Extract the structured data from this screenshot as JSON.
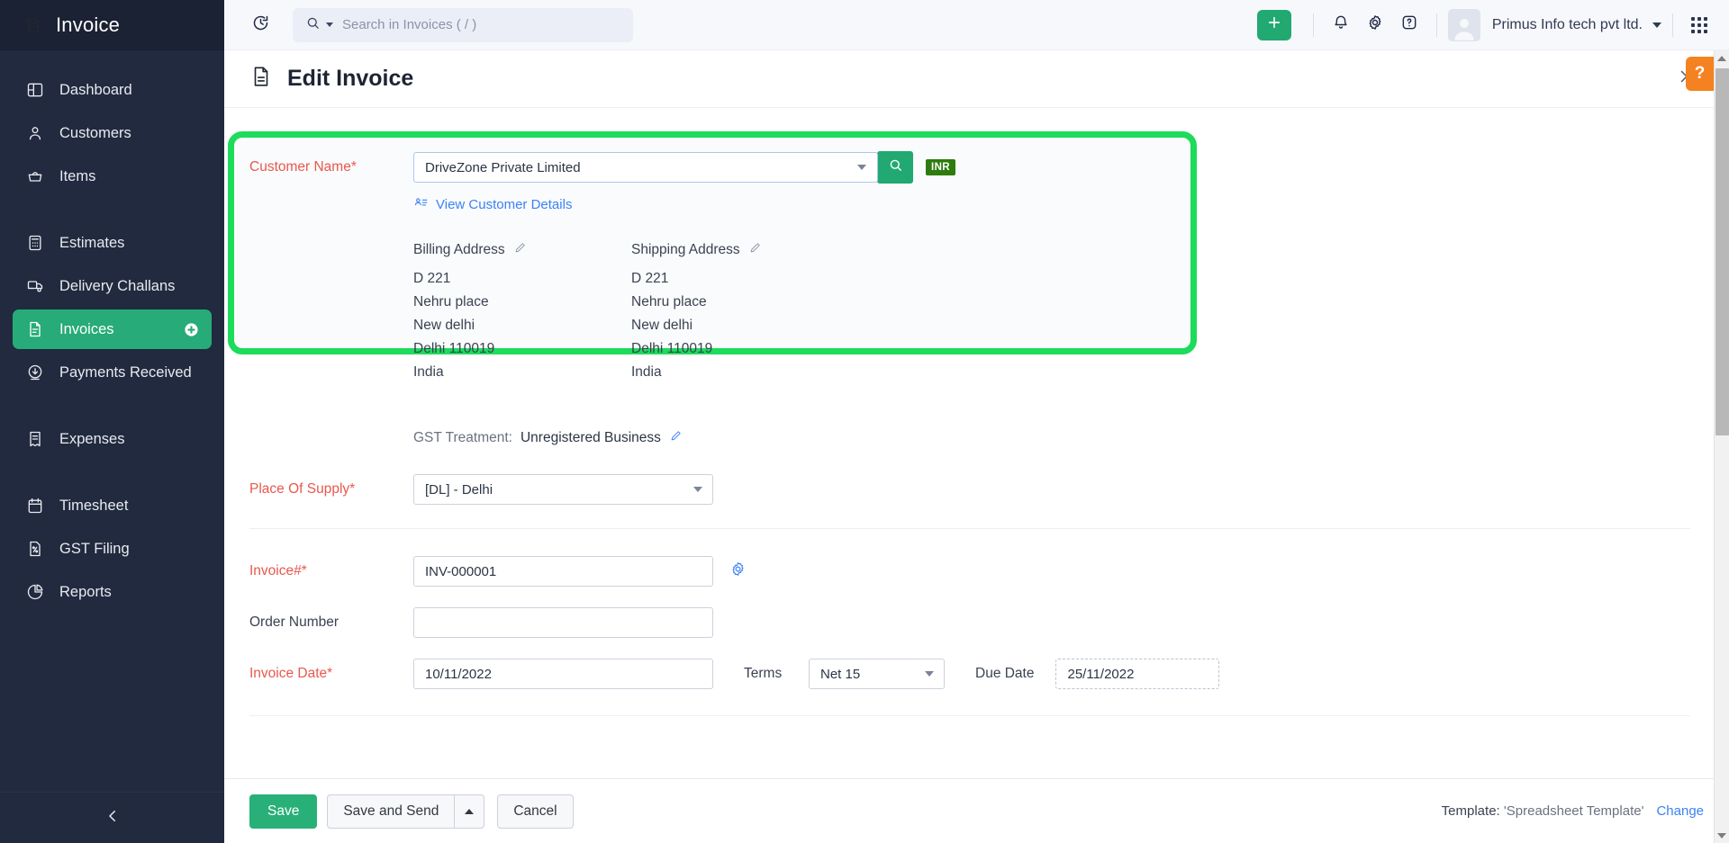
{
  "sidebar": {
    "brand": {
      "title": "Invoice",
      "icon": "invoice-logo-icon"
    },
    "groups": [
      {
        "items": [
          {
            "label": "Dashboard",
            "icon": "dashboard-icon"
          },
          {
            "label": "Customers",
            "icon": "user-icon"
          },
          {
            "label": "Items",
            "icon": "basket-icon"
          }
        ]
      },
      {
        "items": [
          {
            "label": "Estimates",
            "icon": "calculator-icon"
          },
          {
            "label": "Delivery Challans",
            "icon": "truck-icon"
          },
          {
            "label": "Invoices",
            "icon": "document-icon",
            "active": true,
            "trailing_icon": "plus-circle-icon"
          },
          {
            "label": "Payments Received",
            "icon": "download-arrow-icon"
          }
        ]
      },
      {
        "items": [
          {
            "label": "Expenses",
            "icon": "receipt-icon"
          }
        ]
      },
      {
        "items": [
          {
            "label": "Timesheet",
            "icon": "calendar-icon"
          },
          {
            "label": "GST Filing",
            "icon": "percent-doc-icon"
          },
          {
            "label": "Reports",
            "icon": "pie-chart-icon"
          }
        ]
      }
    ],
    "collapse_icon": "chevron-left-icon"
  },
  "topbar": {
    "history_icon": "clock-rewind-icon",
    "search": {
      "placeholder": "Search in Invoices ( / )",
      "value": "",
      "icon": "search-icon"
    },
    "add_icon": "plus-icon",
    "notification_icon": "bell-icon",
    "settings_icon": "gear-icon",
    "help_icon": "question-icon",
    "org_name": "Primus Info tech pvt ltd.",
    "apps_icon": "apps-grid-icon"
  },
  "page": {
    "title": "Edit Invoice",
    "title_icon": "document-icon",
    "close_icon": "close-icon"
  },
  "form": {
    "customer_name": {
      "label": "Customer Name*",
      "value": "DriveZone Private Limited",
      "search_icon": "search-icon",
      "currency_badge": "INR"
    },
    "view_customer_details": {
      "label": "View Customer Details",
      "icon": "contact-card-icon"
    },
    "billing_address": {
      "title": "Billing Address",
      "edit_icon": "pencil-icon",
      "lines": [
        "D 221",
        "Nehru place",
        "New delhi",
        "Delhi 110019",
        "India"
      ]
    },
    "shipping_address": {
      "title": "Shipping Address",
      "edit_icon": "pencil-icon",
      "lines": [
        "D 221",
        "Nehru place",
        "New delhi",
        "Delhi 110019",
        "India"
      ]
    },
    "gst_treatment": {
      "label": "GST Treatment:",
      "value": "Unregistered Business",
      "edit_icon": "pencil-icon"
    },
    "place_of_supply": {
      "label": "Place Of Supply*",
      "value": "[DL] - Delhi"
    },
    "invoice_number": {
      "label": "Invoice#*",
      "value": "INV-000001",
      "settings_icon": "gear-icon"
    },
    "order_number": {
      "label": "Order Number",
      "value": "",
      "placeholder": ""
    },
    "invoice_date": {
      "label": "Invoice Date*",
      "value": "10/11/2022"
    },
    "terms": {
      "label": "Terms",
      "value": "Net 15"
    },
    "due_date": {
      "label": "Due Date",
      "value": "25/11/2022"
    }
  },
  "footer": {
    "save_label": "Save",
    "save_and_send_label": "Save and Send",
    "save_and_send_caret_icon": "caret-up-icon",
    "cancel_label": "Cancel",
    "template_prefix": "Template:",
    "template_name": "'Spreadsheet Template'",
    "change_label": "Change"
  },
  "overlays": {
    "help_tab_label": "?",
    "highlight_color": "#1ddb5b"
  }
}
